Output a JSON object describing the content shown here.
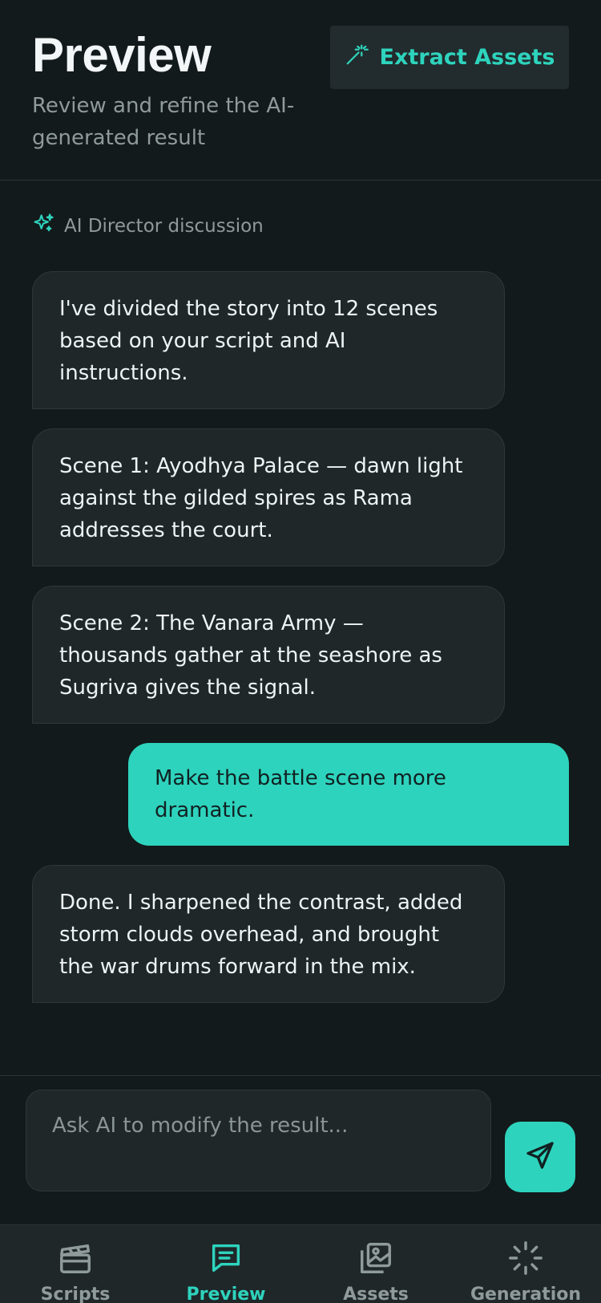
{
  "header": {
    "title": "Preview",
    "subtitle": "Review and refine the AI-generated result",
    "extract_button": {
      "label": "Extract Assets",
      "icon": "magic-wand-icon"
    }
  },
  "discussion": {
    "label": "AI Director discussion",
    "icon": "sparkles-icon"
  },
  "messages": [
    {
      "role": "ai",
      "text": "I've divided the story into 12 scenes based on your script and AI instructions."
    },
    {
      "role": "ai",
      "text": "Scene 1: Ayodhya Palace — dawn light against the gilded spires as Rama addresses the court."
    },
    {
      "role": "ai",
      "text": "Scene 2: The Vanara Army — thousands gather at the seashore as Sugriva gives the signal."
    },
    {
      "role": "user",
      "text": "Make the battle scene more dramatic."
    },
    {
      "role": "ai",
      "text": "Done. I sharpened the contrast, added storm clouds overhead, and brought the war drums forward in the mix."
    }
  ],
  "composer": {
    "placeholder": "Ask AI to modify the result...",
    "send_icon": "send-icon"
  },
  "nav": {
    "items": [
      {
        "label": "Scripts",
        "icon": "clapperboard-icon",
        "active": false
      },
      {
        "label": "Preview",
        "icon": "message-icon",
        "active": true
      },
      {
        "label": "Assets",
        "icon": "image-gallery-icon",
        "active": false
      },
      {
        "label": "Generation",
        "icon": "loader-icon",
        "active": false
      }
    ]
  },
  "colors": {
    "background": "#131a1b",
    "surface": "#1f2729",
    "accent": "#2ed3bd",
    "muted_text": "#8f9a9b"
  }
}
